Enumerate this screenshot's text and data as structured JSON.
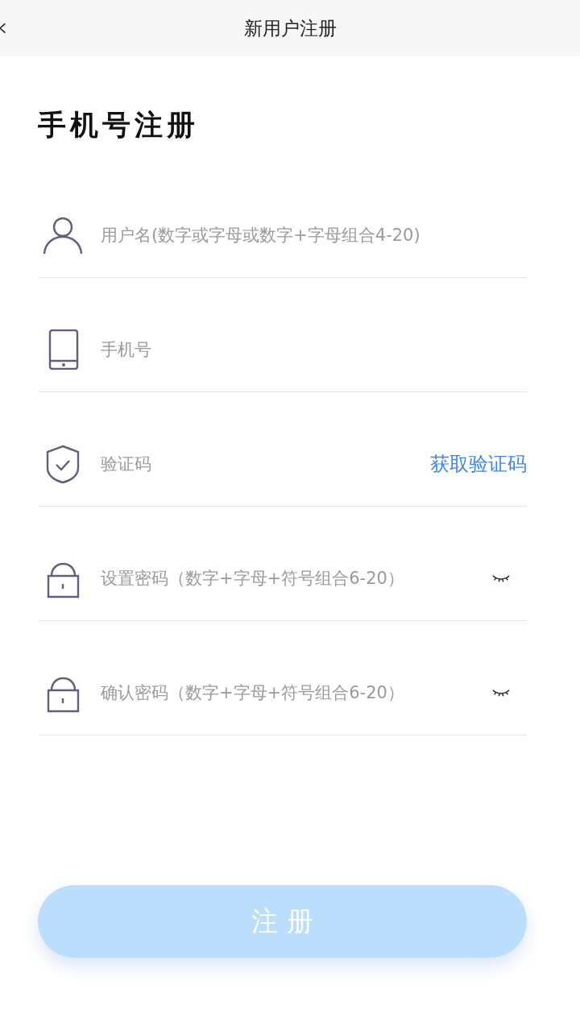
{
  "header": {
    "title": "新用户注册"
  },
  "heading": "手机号注册",
  "fields": [
    {
      "kind": "user",
      "placeholder": "用户名(数字或字母或数字+字母组合4-20)"
    },
    {
      "kind": "phone",
      "placeholder": "手机号"
    },
    {
      "kind": "code",
      "placeholder": "验证码",
      "action": "获取验证码"
    },
    {
      "kind": "password",
      "placeholder": "设置密码（数字+字母+符号组合6-20）",
      "visible": false
    },
    {
      "kind": "password",
      "placeholder": "确认密码（数字+字母+符号组合6-20）",
      "visible": false
    }
  ],
  "submit": {
    "label": "注 册",
    "disabled": true
  }
}
